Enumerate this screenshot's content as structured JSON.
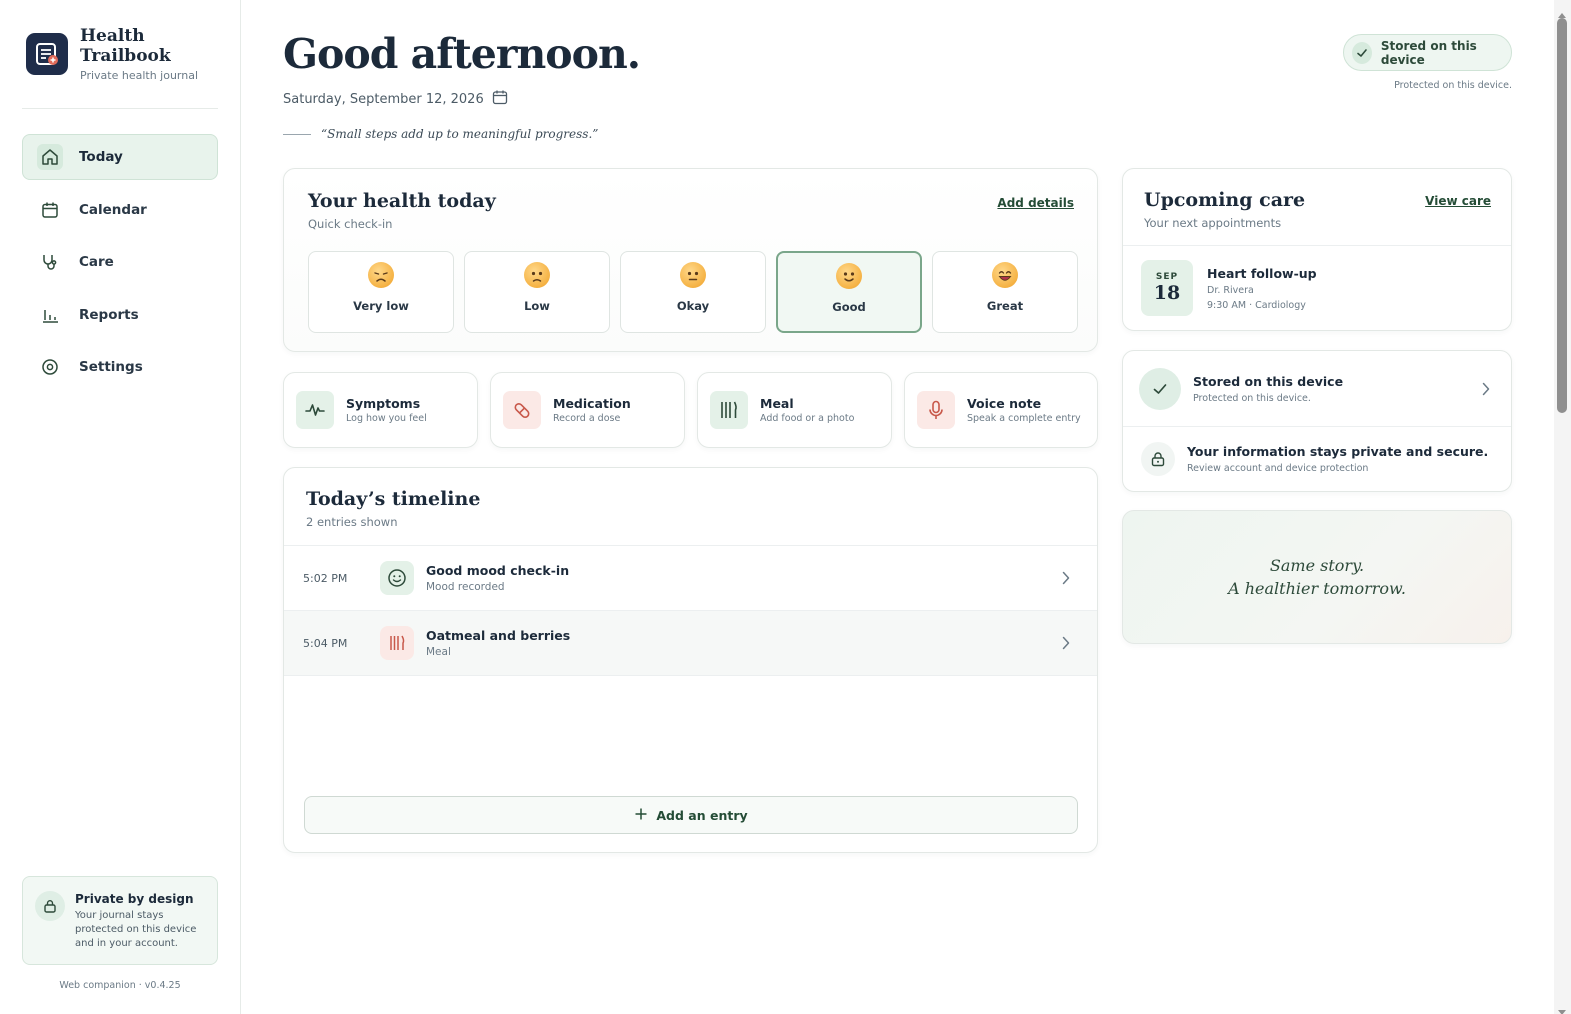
{
  "app": {
    "name_line1": "Health",
    "name_line2": "Trailbook",
    "subtitle": "Private health journal",
    "version": "Web companion · v0.4.25"
  },
  "nav": {
    "items": [
      {
        "label": "Today",
        "icon": "home-icon",
        "active": true
      },
      {
        "label": "Calendar",
        "icon": "calendar-icon"
      },
      {
        "label": "Care",
        "icon": "stethoscope-icon"
      },
      {
        "label": "Reports",
        "icon": "bar-chart-icon"
      },
      {
        "label": "Settings",
        "icon": "gear-icon"
      }
    ]
  },
  "privacy_card": {
    "title": "Private by design",
    "body": "Your journal stays protected on this device and in your account."
  },
  "header": {
    "greeting": "Good afternoon.",
    "date": "Saturday, September 12, 2026",
    "quote": "“Small steps add up to meaningful progress.”",
    "stored_pill": "Stored on this device",
    "protected_note": "Protected on this device."
  },
  "health_today": {
    "title": "Your health today",
    "subtitle": "Quick check-in",
    "action": "Add details",
    "moods": [
      {
        "label": "Very low",
        "face": "very-low"
      },
      {
        "label": "Low",
        "face": "low"
      },
      {
        "label": "Okay",
        "face": "okay"
      },
      {
        "label": "Good",
        "face": "good",
        "selected": true
      },
      {
        "label": "Great",
        "face": "great"
      }
    ]
  },
  "quick_actions": [
    {
      "title": "Symptoms",
      "subtitle": "Log how you feel",
      "icon": "pulse-icon",
      "tone": "green"
    },
    {
      "title": "Medication",
      "subtitle": "Record a dose",
      "icon": "pill-icon",
      "tone": "red"
    },
    {
      "title": "Meal",
      "subtitle": "Add food or a photo",
      "icon": "utensils-icon",
      "tone": "green"
    },
    {
      "title": "Voice note",
      "subtitle": "Speak a complete entry",
      "icon": "microphone-icon",
      "tone": "red"
    }
  ],
  "timeline": {
    "title": "Today’s timeline",
    "subtitle": "2 entries shown",
    "entries": [
      {
        "time": "5:02 PM",
        "title": "Good mood check-in",
        "subtitle": "Mood recorded",
        "icon": "smile-icon"
      },
      {
        "time": "5:04 PM",
        "title": "Oatmeal and berries",
        "subtitle": "Meal",
        "icon": "utensils-icon"
      }
    ],
    "add_label": "Add an entry"
  },
  "upcoming": {
    "title": "Upcoming care",
    "subtitle": "Your next appointments",
    "action": "View care",
    "appointment": {
      "month": "SEP",
      "day": "18",
      "title": "Heart follow-up",
      "doctor": "Dr. Rivera",
      "detail": "9:30 AM · Cardiology"
    }
  },
  "storage": {
    "title": "Stored on this device",
    "subtitle": "Protected on this device.",
    "security_title": "Your information stays private and secure.",
    "security_sub": "Review account and device protection"
  },
  "motto": {
    "line1": "Same story.",
    "line2": "A healthier tomorrow."
  },
  "colors": {
    "accent_green": "#244c36",
    "navy": "#1f2d4a",
    "soft_green": "#e4f1e8",
    "soft_red": "#fbe9e6",
    "icon_red": "#c8584a"
  }
}
